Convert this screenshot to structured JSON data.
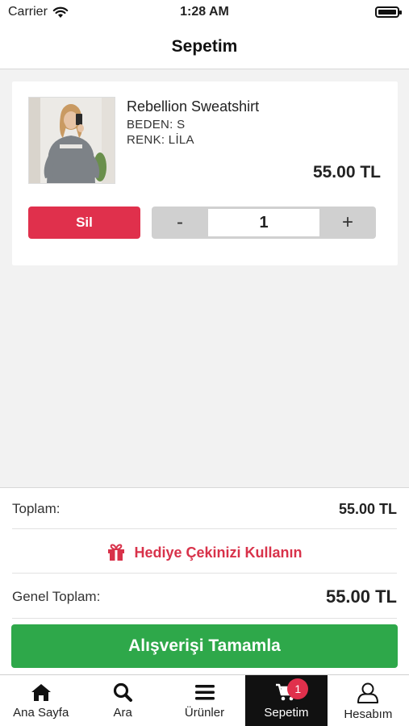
{
  "status_bar": {
    "carrier": "Carrier",
    "time": "1:28 AM"
  },
  "header": {
    "title": "Sepetim"
  },
  "cart": {
    "items": [
      {
        "name": "Rebellion Sweatshirt",
        "size": "BEDEN: S",
        "color": "RENK: LİLA",
        "price": "55.00 TL",
        "quantity": "1"
      }
    ],
    "delete_label": "Sil",
    "decrement_label": "-",
    "increment_label": "+"
  },
  "summary": {
    "subtotal_label": "Toplam:",
    "subtotal_value": "55.00 TL",
    "gift_label": "Hediye Çekinizi Kullanın",
    "total_label": "Genel Toplam:",
    "total_value": "55.00 TL",
    "checkout_label": "Alışverişi Tamamla"
  },
  "tabs": [
    {
      "label": "Ana Sayfa",
      "icon": "home-icon"
    },
    {
      "label": "Ara",
      "icon": "search-icon"
    },
    {
      "label": "Ürünler",
      "icon": "menu-icon"
    },
    {
      "label": "Sepetim",
      "icon": "cart-icon",
      "active": true,
      "badge": "1"
    },
    {
      "label": "Hesabım",
      "icon": "user-icon"
    }
  ],
  "colors": {
    "accent_red": "#e0304c",
    "checkout_green": "#2ea84a",
    "active_tab_bg": "#111111"
  }
}
